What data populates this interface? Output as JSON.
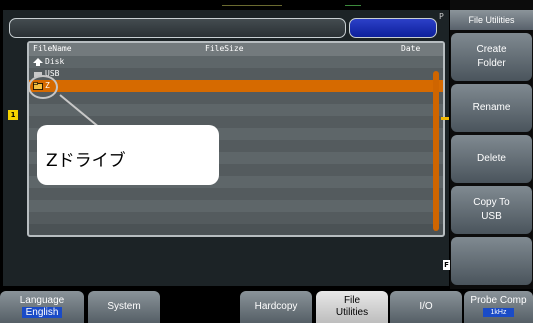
{
  "screen": {
    "path_text": "",
    "trigger_label": "P",
    "ch1_label": "1",
    "f_label": "F"
  },
  "file_list": {
    "headers": {
      "name": "FileName",
      "size": "FileSize",
      "date": "Date"
    },
    "rows": [
      {
        "name": "Disk",
        "icon": "up-arrow-icon"
      },
      {
        "name": "USB",
        "icon": "usb-icon"
      },
      {
        "name": "Z",
        "icon": "folder-icon",
        "selected": true
      },
      {
        "name": ""
      },
      {
        "name": ""
      },
      {
        "name": ""
      },
      {
        "name": ""
      },
      {
        "name": ""
      },
      {
        "name": ""
      },
      {
        "name": ""
      },
      {
        "name": ""
      },
      {
        "name": ""
      },
      {
        "name": ""
      },
      {
        "name": ""
      }
    ]
  },
  "callout": {
    "text": "Zドライブ"
  },
  "side_menu": {
    "title": "File Utilities",
    "buttons": [
      {
        "label": "Create\nFolder"
      },
      {
        "label": "Rename"
      },
      {
        "label": "Delete"
      },
      {
        "label": "Copy To\nUSB"
      },
      {
        "label": ""
      }
    ]
  },
  "bottom_menu": {
    "language": {
      "label": "Language",
      "value": "English"
    },
    "system": {
      "label": "System"
    },
    "hardcopy": {
      "label": "Hardcopy"
    },
    "file_utilities": {
      "label": "File\nUtilities"
    },
    "io": {
      "label": "I/O"
    },
    "probe_comp": {
      "label": "Probe Comp",
      "value": "1kHz"
    }
  },
  "colors": {
    "selection": "#d66a00",
    "accent_blue": "#1a4bc7",
    "ch1_yellow": "#f5d300"
  }
}
